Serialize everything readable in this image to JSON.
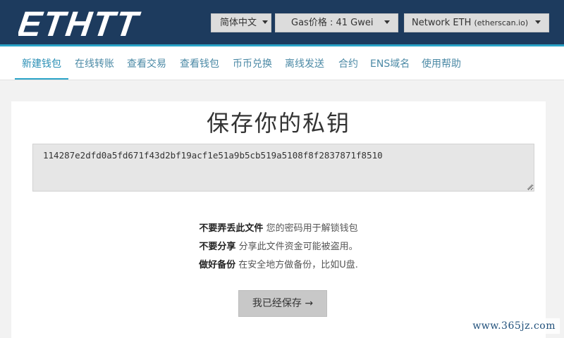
{
  "header": {
    "logo_text": "ETHTT",
    "language_select": "简体中文",
    "gas_price": "Gas价格 : 41 Gwei",
    "network_main": "Network ETH",
    "network_sub": "(etherscan.io)"
  },
  "nav": {
    "items": [
      {
        "label": "新建钱包"
      },
      {
        "label": "在线转账"
      },
      {
        "label": "查看交易"
      },
      {
        "label": "查看钱包"
      },
      {
        "label": "币币兑换"
      },
      {
        "label": "离线发送"
      },
      {
        "label": "合约"
      },
      {
        "label": "ENS域名"
      },
      {
        "label": "使用帮助"
      }
    ],
    "active_index": 0
  },
  "main": {
    "title": "保存你的私钥",
    "private_key": "114287e2dfd0a5fd671f43d2bf19acf1e51a9b5cb519a5108f8f2837871f8510",
    "warnings": [
      {
        "bold": "不要弄丢此文件",
        "text": " 您的密码用于解锁钱包"
      },
      {
        "bold": "不要分享",
        "text": " 分享此文件资金可能被盗用。"
      },
      {
        "bold": "做好备份",
        "text": " 在安全地方做备份，比如U盘."
      }
    ],
    "save_button": "我已经保存 →"
  },
  "watermark": "www.365jz.com",
  "colors": {
    "header_bg": "#1d3b5e",
    "accent": "#2aa3c7",
    "nav_text": "#4c8aa6"
  }
}
